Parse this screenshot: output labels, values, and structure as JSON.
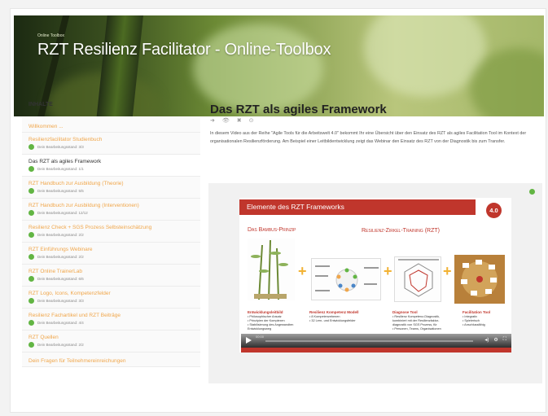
{
  "hero": {
    "kicker": "Online Toolbox",
    "title": "RZT Resilienz Facilitator - Online-Toolbox"
  },
  "sidebar": {
    "heading": "INHALTE",
    "items": [
      {
        "label": "Willkommen ...",
        "status": null,
        "active": false
      },
      {
        "label": "Resilienzfacilitator Studienbuch",
        "status": "Dein Bearbeitungsstand: 3/3",
        "active": false
      },
      {
        "label": "Das RZT als agiles Framework",
        "status": "Dein Bearbeitungsstand: 1/1",
        "active": true
      },
      {
        "label": "RZT Handbuch zur Ausbildung (Theorie)",
        "status": "Dein Bearbeitungsstand: 5/5",
        "active": false
      },
      {
        "label": "RZT Handbuch zur Ausbildung (Interventionen)",
        "status": "Dein Bearbeitungsstand: 12/12",
        "active": false
      },
      {
        "label": "Resilienz Check + SGS Prozess Selbsteinschätzung",
        "status": "Dein Bearbeitungsstand: 2/2",
        "active": false
      },
      {
        "label": "RZT Einführungs Webinare",
        "status": "Dein Bearbeitungsstand: 2/2",
        "active": false
      },
      {
        "label": "RZT Online TrainerLab",
        "status": "Dein Bearbeitungsstand: 6/6",
        "active": false
      },
      {
        "label": "RZT Logo, Icons, Kompetenzfelder",
        "status": "Dein Bearbeitungsstand: 3/3",
        "active": false
      },
      {
        "label": "Resilienz Fachartikel und RZT Beiträge",
        "status": "Dein Bearbeitungsstand: 4/4",
        "active": false
      },
      {
        "label": "RZT Quellen",
        "status": "Dein Bearbeitungsstand: 2/2",
        "active": false
      },
      {
        "label": "Dein Fragen für Teilnehmereinreichungen",
        "status": null,
        "active": false
      }
    ]
  },
  "main": {
    "title": "Das RZT als agiles Framework",
    "share_icons": [
      "share-icon",
      "view-icon",
      "close-icon",
      "settings-icon"
    ],
    "description": "In diesem Video aus der Reihe \"Agile Tools für die Arbeitswelt 4.0\" bekommt Ihr eine Übersicht über den Einsatz des RZT als agiles Facilitation Tool im Kontext der organisationalen Resilienzförderung. Am Beispiel einer Leitbildentwicklung zeigt das Webinar den Einsatz des RZT von der Diagnostik bis zum Transfer."
  },
  "video": {
    "slide_title": "Elemente des RZT Frameworks",
    "badge": "4.0",
    "subtitle_left": "Das Bambus-Prinzip",
    "subtitle_right": "Resilienz-Zirkel-Training (RZT)",
    "columns": [
      {
        "title": "Entwicklungsleitbild",
        "items": [
          "• Philosophischer Ansatz",
          "• Prinzipien der Komplexen",
          "• Stabilisierung des Angewandten",
          "  Entwicklungsweg"
        ]
      },
      {
        "title": "Resilienz Kompetenz Modell",
        "items": [
          "• 8 Kompetenzebenen",
          "• 32 Lern- und Entwicklungsfelder"
        ]
      },
      {
        "title": "Diagnose Tool",
        "items": [
          "• Resilienz Kompetenz-Diagnostik,",
          "  kombiniert mit der Resilienzfaktor-",
          "  diagnostik von SGS Prozess, für",
          "• Personen, Teams, Organisationen"
        ]
      },
      {
        "title": "Facilitation Tool",
        "items": [
          "• Integrativ",
          "• Spielerisch",
          "• Anschlussfähig"
        ]
      }
    ],
    "time": "00:00",
    "controls": [
      "volume-icon",
      "settings-icon",
      "fullscreen-icon"
    ],
    "progress": 0
  },
  "colors": {
    "accent_orange": "#f0a64a",
    "complete_green": "#62b543",
    "slide_red": "#c0362c"
  }
}
